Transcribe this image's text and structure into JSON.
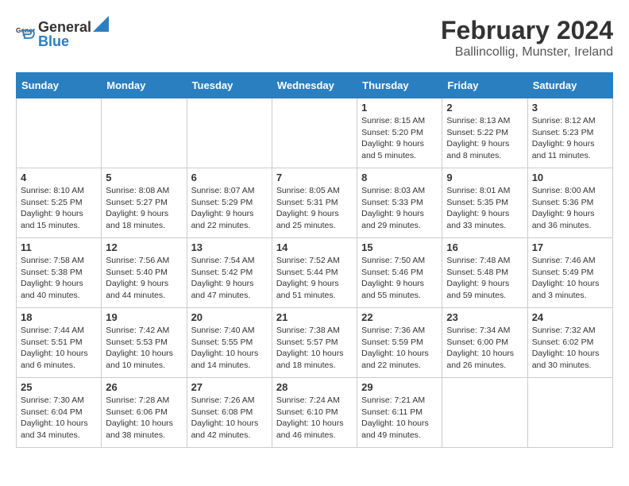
{
  "header": {
    "logo_general": "General",
    "logo_blue": "Blue",
    "title": "February 2024",
    "subtitle": "Ballincollig, Munster, Ireland"
  },
  "columns": [
    "Sunday",
    "Monday",
    "Tuesday",
    "Wednesday",
    "Thursday",
    "Friday",
    "Saturday"
  ],
  "weeks": [
    [
      {
        "day": "",
        "info": ""
      },
      {
        "day": "",
        "info": ""
      },
      {
        "day": "",
        "info": ""
      },
      {
        "day": "",
        "info": ""
      },
      {
        "day": "1",
        "info": "Sunrise: 8:15 AM\nSunset: 5:20 PM\nDaylight: 9 hours\nand 5 minutes."
      },
      {
        "day": "2",
        "info": "Sunrise: 8:13 AM\nSunset: 5:22 PM\nDaylight: 9 hours\nand 8 minutes."
      },
      {
        "day": "3",
        "info": "Sunrise: 8:12 AM\nSunset: 5:23 PM\nDaylight: 9 hours\nand 11 minutes."
      }
    ],
    [
      {
        "day": "4",
        "info": "Sunrise: 8:10 AM\nSunset: 5:25 PM\nDaylight: 9 hours\nand 15 minutes."
      },
      {
        "day": "5",
        "info": "Sunrise: 8:08 AM\nSunset: 5:27 PM\nDaylight: 9 hours\nand 18 minutes."
      },
      {
        "day": "6",
        "info": "Sunrise: 8:07 AM\nSunset: 5:29 PM\nDaylight: 9 hours\nand 22 minutes."
      },
      {
        "day": "7",
        "info": "Sunrise: 8:05 AM\nSunset: 5:31 PM\nDaylight: 9 hours\nand 25 minutes."
      },
      {
        "day": "8",
        "info": "Sunrise: 8:03 AM\nSunset: 5:33 PM\nDaylight: 9 hours\nand 29 minutes."
      },
      {
        "day": "9",
        "info": "Sunrise: 8:01 AM\nSunset: 5:35 PM\nDaylight: 9 hours\nand 33 minutes."
      },
      {
        "day": "10",
        "info": "Sunrise: 8:00 AM\nSunset: 5:36 PM\nDaylight: 9 hours\nand 36 minutes."
      }
    ],
    [
      {
        "day": "11",
        "info": "Sunrise: 7:58 AM\nSunset: 5:38 PM\nDaylight: 9 hours\nand 40 minutes."
      },
      {
        "day": "12",
        "info": "Sunrise: 7:56 AM\nSunset: 5:40 PM\nDaylight: 9 hours\nand 44 minutes."
      },
      {
        "day": "13",
        "info": "Sunrise: 7:54 AM\nSunset: 5:42 PM\nDaylight: 9 hours\nand 47 minutes."
      },
      {
        "day": "14",
        "info": "Sunrise: 7:52 AM\nSunset: 5:44 PM\nDaylight: 9 hours\nand 51 minutes."
      },
      {
        "day": "15",
        "info": "Sunrise: 7:50 AM\nSunset: 5:46 PM\nDaylight: 9 hours\nand 55 minutes."
      },
      {
        "day": "16",
        "info": "Sunrise: 7:48 AM\nSunset: 5:48 PM\nDaylight: 9 hours\nand 59 minutes."
      },
      {
        "day": "17",
        "info": "Sunrise: 7:46 AM\nSunset: 5:49 PM\nDaylight: 10 hours\nand 3 minutes."
      }
    ],
    [
      {
        "day": "18",
        "info": "Sunrise: 7:44 AM\nSunset: 5:51 PM\nDaylight: 10 hours\nand 6 minutes."
      },
      {
        "day": "19",
        "info": "Sunrise: 7:42 AM\nSunset: 5:53 PM\nDaylight: 10 hours\nand 10 minutes."
      },
      {
        "day": "20",
        "info": "Sunrise: 7:40 AM\nSunset: 5:55 PM\nDaylight: 10 hours\nand 14 minutes."
      },
      {
        "day": "21",
        "info": "Sunrise: 7:38 AM\nSunset: 5:57 PM\nDaylight: 10 hours\nand 18 minutes."
      },
      {
        "day": "22",
        "info": "Sunrise: 7:36 AM\nSunset: 5:59 PM\nDaylight: 10 hours\nand 22 minutes."
      },
      {
        "day": "23",
        "info": "Sunrise: 7:34 AM\nSunset: 6:00 PM\nDaylight: 10 hours\nand 26 minutes."
      },
      {
        "day": "24",
        "info": "Sunrise: 7:32 AM\nSunset: 6:02 PM\nDaylight: 10 hours\nand 30 minutes."
      }
    ],
    [
      {
        "day": "25",
        "info": "Sunrise: 7:30 AM\nSunset: 6:04 PM\nDaylight: 10 hours\nand 34 minutes."
      },
      {
        "day": "26",
        "info": "Sunrise: 7:28 AM\nSunset: 6:06 PM\nDaylight: 10 hours\nand 38 minutes."
      },
      {
        "day": "27",
        "info": "Sunrise: 7:26 AM\nSunset: 6:08 PM\nDaylight: 10 hours\nand 42 minutes."
      },
      {
        "day": "28",
        "info": "Sunrise: 7:24 AM\nSunset: 6:10 PM\nDaylight: 10 hours\nand 46 minutes."
      },
      {
        "day": "29",
        "info": "Sunrise: 7:21 AM\nSunset: 6:11 PM\nDaylight: 10 hours\nand 49 minutes."
      },
      {
        "day": "",
        "info": ""
      },
      {
        "day": "",
        "info": ""
      }
    ]
  ]
}
